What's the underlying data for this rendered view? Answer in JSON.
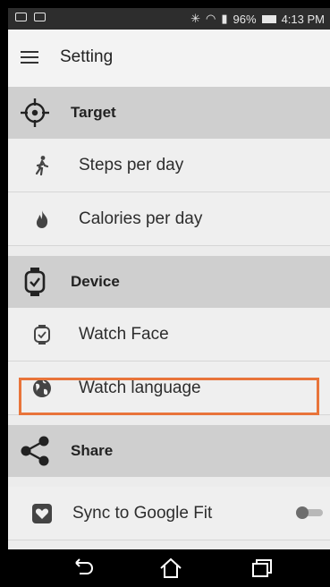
{
  "statusbar": {
    "battery": "96%",
    "time": "4:13 PM"
  },
  "header": {
    "title": "Setting"
  },
  "sections": {
    "target": {
      "label": "Target"
    },
    "device": {
      "label": "Device"
    },
    "share": {
      "label": "Share"
    }
  },
  "items": {
    "steps": {
      "label": "Steps per day"
    },
    "calories": {
      "label": "Calories per day"
    },
    "watch_face": {
      "label": "Watch Face"
    },
    "watch_language": {
      "label": "Watch language"
    },
    "sync_google_fit": {
      "label": "Sync to Google Fit"
    }
  },
  "colors": {
    "highlight": "#e8743a",
    "section_bg": "#cfcfcf",
    "item_bg": "#efefef"
  },
  "icons": [
    "menu-icon",
    "target-crosshair-icon",
    "walking-person-icon",
    "flame-icon",
    "smartwatch-icon",
    "watch-outline-icon",
    "globe-icon",
    "share-icon",
    "google-fit-heart-icon",
    "back-icon",
    "home-icon",
    "recents-icon"
  ],
  "toggle_sync_google_fit": {
    "on": false
  }
}
